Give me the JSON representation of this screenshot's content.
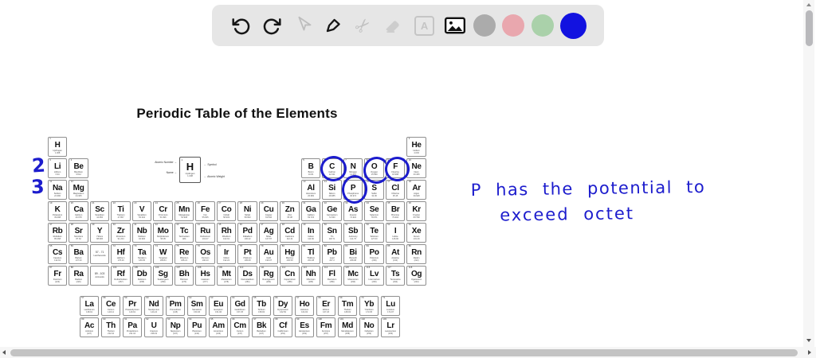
{
  "toolbar": {
    "text_tool_letter": "A",
    "tools": [
      {
        "id": "undo",
        "icon": "undo-arrow-icon",
        "enabled": true
      },
      {
        "id": "redo",
        "icon": "redo-arrow-icon",
        "enabled": true
      },
      {
        "id": "select",
        "icon": "cursor-icon",
        "enabled": false
      },
      {
        "id": "pen",
        "icon": "pen-icon",
        "enabled": true
      },
      {
        "id": "cut",
        "icon": "scissors-icon",
        "enabled": false
      },
      {
        "id": "eraser",
        "icon": "eraser-icon",
        "enabled": false
      },
      {
        "id": "text",
        "icon": "text-box-icon",
        "enabled": false
      },
      {
        "id": "image",
        "icon": "image-icon",
        "enabled": true
      }
    ],
    "color_swatches": [
      {
        "name": "gray",
        "hex": "#ababab",
        "selected": false
      },
      {
        "name": "pink",
        "hex": "#e9a7ae",
        "selected": false
      },
      {
        "name": "green",
        "hex": "#aad1aa",
        "selected": false
      },
      {
        "name": "blue",
        "hex": "#1212e0",
        "selected": true
      }
    ],
    "scissors_glyph": "✂"
  },
  "table": {
    "title": "Periodic Table of the Elements",
    "legend": {
      "atomic_number_label": "Atomic Number →",
      "name_label": "Name →",
      "symbol_label": "← Symbol",
      "atomic_weight_label": "← Atomic Weight",
      "example": {
        "n": "1",
        "s": "H",
        "nm": "Hydrogen",
        "w": "1.008"
      }
    },
    "group_placeholders": [
      {
        "r": 6,
        "c": 3,
        "range": "57 - 71",
        "label": "Lanthanoids"
      },
      {
        "r": 7,
        "c": 3,
        "range": "89 - 103",
        "label": "Actinoids"
      }
    ],
    "elements": [
      {
        "n": 1,
        "s": "H",
        "nm": "Hydrogen",
        "w": "1.008",
        "r": 1,
        "c": 1
      },
      {
        "n": 2,
        "s": "He",
        "nm": "Helium",
        "w": "4.003",
        "r": 1,
        "c": 18
      },
      {
        "n": 3,
        "s": "Li",
        "nm": "Lithium",
        "w": "6.94",
        "r": 2,
        "c": 1
      },
      {
        "n": 4,
        "s": "Be",
        "nm": "Beryllium",
        "w": "9.012",
        "r": 2,
        "c": 2
      },
      {
        "n": 5,
        "s": "B",
        "nm": "Boron",
        "w": "10.81",
        "r": 2,
        "c": 13
      },
      {
        "n": 6,
        "s": "C",
        "nm": "Carbon",
        "w": "12.011",
        "r": 2,
        "c": 14
      },
      {
        "n": 7,
        "s": "N",
        "nm": "Nitrogen",
        "w": "14.007",
        "r": 2,
        "c": 15
      },
      {
        "n": 8,
        "s": "O",
        "nm": "Oxygen",
        "w": "15.999",
        "r": 2,
        "c": 16
      },
      {
        "n": 9,
        "s": "F",
        "nm": "Fluorine",
        "w": "18.998",
        "r": 2,
        "c": 17
      },
      {
        "n": 10,
        "s": "Ne",
        "nm": "Neon",
        "w": "20.180",
        "r": 2,
        "c": 18
      },
      {
        "n": 11,
        "s": "Na",
        "nm": "Sodium",
        "w": "22.990",
        "r": 3,
        "c": 1
      },
      {
        "n": 12,
        "s": "Mg",
        "nm": "Magnesium",
        "w": "24.305",
        "r": 3,
        "c": 2
      },
      {
        "n": 13,
        "s": "Al",
        "nm": "Aluminium",
        "w": "26.982",
        "r": 3,
        "c": 13
      },
      {
        "n": 14,
        "s": "Si",
        "nm": "Silicon",
        "w": "28.085",
        "r": 3,
        "c": 14
      },
      {
        "n": 15,
        "s": "P",
        "nm": "Phosphorus",
        "w": "30.974",
        "r": 3,
        "c": 15
      },
      {
        "n": 16,
        "s": "S",
        "nm": "Sulfur",
        "w": "32.06",
        "r": 3,
        "c": 16
      },
      {
        "n": 17,
        "s": "Cl",
        "nm": "Chlorine",
        "w": "35.45",
        "r": 3,
        "c": 17
      },
      {
        "n": 18,
        "s": "Ar",
        "nm": "Argon",
        "w": "39.948",
        "r": 3,
        "c": 18
      },
      {
        "n": 19,
        "s": "K",
        "nm": "Potassium",
        "w": "39.098",
        "r": 4,
        "c": 1
      },
      {
        "n": 20,
        "s": "Ca",
        "nm": "Calcium",
        "w": "40.078",
        "r": 4,
        "c": 2
      },
      {
        "n": 21,
        "s": "Sc",
        "nm": "Scandium",
        "w": "44.956",
        "r": 4,
        "c": 3
      },
      {
        "n": 22,
        "s": "Ti",
        "nm": "Titanium",
        "w": "47.867",
        "r": 4,
        "c": 4
      },
      {
        "n": 23,
        "s": "V",
        "nm": "Vanadium",
        "w": "50.942",
        "r": 4,
        "c": 5
      },
      {
        "n": 24,
        "s": "Cr",
        "nm": "Chromium",
        "w": "51.996",
        "r": 4,
        "c": 6
      },
      {
        "n": 25,
        "s": "Mn",
        "nm": "Manganese",
        "w": "54.938",
        "r": 4,
        "c": 7
      },
      {
        "n": 26,
        "s": "Fe",
        "nm": "Iron",
        "w": "55.845",
        "r": 4,
        "c": 8
      },
      {
        "n": 27,
        "s": "Co",
        "nm": "Cobalt",
        "w": "58.933",
        "r": 4,
        "c": 9
      },
      {
        "n": 28,
        "s": "Ni",
        "nm": "Nickel",
        "w": "58.693",
        "r": 4,
        "c": 10
      },
      {
        "n": 29,
        "s": "Cu",
        "nm": "Copper",
        "w": "63.546",
        "r": 4,
        "c": 11
      },
      {
        "n": 30,
        "s": "Zn",
        "nm": "Zinc",
        "w": "65.38",
        "r": 4,
        "c": 12
      },
      {
        "n": 31,
        "s": "Ga",
        "nm": "Gallium",
        "w": "69.723",
        "r": 4,
        "c": 13
      },
      {
        "n": 32,
        "s": "Ge",
        "nm": "Germanium",
        "w": "72.630",
        "r": 4,
        "c": 14
      },
      {
        "n": 33,
        "s": "As",
        "nm": "Arsenic",
        "w": "74.922",
        "r": 4,
        "c": 15
      },
      {
        "n": 34,
        "s": "Se",
        "nm": "Selenium",
        "w": "78.971",
        "r": 4,
        "c": 16
      },
      {
        "n": 35,
        "s": "Br",
        "nm": "Bromine",
        "w": "79.904",
        "r": 4,
        "c": 17
      },
      {
        "n": 36,
        "s": "Kr",
        "nm": "Krypton",
        "w": "83.798",
        "r": 4,
        "c": 18
      },
      {
        "n": 37,
        "s": "Rb",
        "nm": "Rubidium",
        "w": "85.468",
        "r": 5,
        "c": 1
      },
      {
        "n": 38,
        "s": "Sr",
        "nm": "Strontium",
        "w": "87.62",
        "r": 5,
        "c": 2
      },
      {
        "n": 39,
        "s": "Y",
        "nm": "Yttrium",
        "w": "88.906",
        "r": 5,
        "c": 3
      },
      {
        "n": 40,
        "s": "Zr",
        "nm": "Zirconium",
        "w": "91.224",
        "r": 5,
        "c": 4
      },
      {
        "n": 41,
        "s": "Nb",
        "nm": "Niobium",
        "w": "92.906",
        "r": 5,
        "c": 5
      },
      {
        "n": 42,
        "s": "Mo",
        "nm": "Molybdenum",
        "w": "95.95",
        "r": 5,
        "c": 6
      },
      {
        "n": 43,
        "s": "Tc",
        "nm": "Technetium",
        "w": "(98)",
        "r": 5,
        "c": 7
      },
      {
        "n": 44,
        "s": "Ru",
        "nm": "Ruthenium",
        "w": "101.07",
        "r": 5,
        "c": 8
      },
      {
        "n": 45,
        "s": "Rh",
        "nm": "Rhodium",
        "w": "102.91",
        "r": 5,
        "c": 9
      },
      {
        "n": 46,
        "s": "Pd",
        "nm": "Palladium",
        "w": "106.42",
        "r": 5,
        "c": 10
      },
      {
        "n": 47,
        "s": "Ag",
        "nm": "Silver",
        "w": "107.87",
        "r": 5,
        "c": 11
      },
      {
        "n": 48,
        "s": "Cd",
        "nm": "Cadmium",
        "w": "112.41",
        "r": 5,
        "c": 12
      },
      {
        "n": 49,
        "s": "In",
        "nm": "Indium",
        "w": "114.82",
        "r": 5,
        "c": 13
      },
      {
        "n": 50,
        "s": "Sn",
        "nm": "Tin",
        "w": "118.71",
        "r": 5,
        "c": 14
      },
      {
        "n": 51,
        "s": "Sb",
        "nm": "Antimony",
        "w": "121.76",
        "r": 5,
        "c": 15
      },
      {
        "n": 52,
        "s": "Te",
        "nm": "Tellurium",
        "w": "127.60",
        "r": 5,
        "c": 16
      },
      {
        "n": 53,
        "s": "I",
        "nm": "Iodine",
        "w": "126.90",
        "r": 5,
        "c": 17
      },
      {
        "n": 54,
        "s": "Xe",
        "nm": "Xenon",
        "w": "131.29",
        "r": 5,
        "c": 18
      },
      {
        "n": 55,
        "s": "Cs",
        "nm": "Caesium",
        "w": "132.91",
        "r": 6,
        "c": 1
      },
      {
        "n": 56,
        "s": "Ba",
        "nm": "Barium",
        "w": "137.33",
        "r": 6,
        "c": 2
      },
      {
        "n": 72,
        "s": "Hf",
        "nm": "Hafnium",
        "w": "178.49",
        "r": 6,
        "c": 4
      },
      {
        "n": 73,
        "s": "Ta",
        "nm": "Tantalum",
        "w": "180.95",
        "r": 6,
        "c": 5
      },
      {
        "n": 74,
        "s": "W",
        "nm": "Tungsten",
        "w": "183.84",
        "r": 6,
        "c": 6
      },
      {
        "n": 75,
        "s": "Re",
        "nm": "Rhenium",
        "w": "186.21",
        "r": 6,
        "c": 7
      },
      {
        "n": 76,
        "s": "Os",
        "nm": "Osmium",
        "w": "190.23",
        "r": 6,
        "c": 8
      },
      {
        "n": 77,
        "s": "Ir",
        "nm": "Iridium",
        "w": "192.22",
        "r": 6,
        "c": 9
      },
      {
        "n": 78,
        "s": "Pt",
        "nm": "Platinum",
        "w": "195.08",
        "r": 6,
        "c": 10
      },
      {
        "n": 79,
        "s": "Au",
        "nm": "Gold",
        "w": "196.97",
        "r": 6,
        "c": 11
      },
      {
        "n": 80,
        "s": "Hg",
        "nm": "Mercury",
        "w": "200.59",
        "r": 6,
        "c": 12
      },
      {
        "n": 81,
        "s": "Tl",
        "nm": "Thallium",
        "w": "204.38",
        "r": 6,
        "c": 13
      },
      {
        "n": 82,
        "s": "Pb",
        "nm": "Lead",
        "w": "207.2",
        "r": 6,
        "c": 14
      },
      {
        "n": 83,
        "s": "Bi",
        "nm": "Bismuth",
        "w": "208.98",
        "r": 6,
        "c": 15
      },
      {
        "n": 84,
        "s": "Po",
        "nm": "Polonium",
        "w": "(209)",
        "r": 6,
        "c": 16
      },
      {
        "n": 85,
        "s": "At",
        "nm": "Astatine",
        "w": "(210)",
        "r": 6,
        "c": 17
      },
      {
        "n": 86,
        "s": "Rn",
        "nm": "Radon",
        "w": "(222)",
        "r": 6,
        "c": 18
      },
      {
        "n": 87,
        "s": "Fr",
        "nm": "Francium",
        "w": "(223)",
        "r": 7,
        "c": 1
      },
      {
        "n": 88,
        "s": "Ra",
        "nm": "Radium",
        "w": "(226)",
        "r": 7,
        "c": 2
      },
      {
        "n": 104,
        "s": "Rf",
        "nm": "Rutherfordium",
        "w": "(267)",
        "r": 7,
        "c": 4
      },
      {
        "n": 105,
        "s": "Db",
        "nm": "Dubnium",
        "w": "(268)",
        "r": 7,
        "c": 5
      },
      {
        "n": 106,
        "s": "Sg",
        "nm": "Seaborgium",
        "w": "(269)",
        "r": 7,
        "c": 6
      },
      {
        "n": 107,
        "s": "Bh",
        "nm": "Bohrium",
        "w": "(270)",
        "r": 7,
        "c": 7
      },
      {
        "n": 108,
        "s": "Hs",
        "nm": "Hassium",
        "w": "(277)",
        "r": 7,
        "c": 8
      },
      {
        "n": 109,
        "s": "Mt",
        "nm": "Meitnerium",
        "w": "(278)",
        "r": 7,
        "c": 9
      },
      {
        "n": 110,
        "s": "Ds",
        "nm": "Darmstadtium",
        "w": "(281)",
        "r": 7,
        "c": 10
      },
      {
        "n": 111,
        "s": "Rg",
        "nm": "Roentgenium",
        "w": "(282)",
        "r": 7,
        "c": 11
      },
      {
        "n": 112,
        "s": "Cn",
        "nm": "Copernicium",
        "w": "(285)",
        "r": 7,
        "c": 12
      },
      {
        "n": 113,
        "s": "Nh",
        "nm": "Nihonium",
        "w": "(286)",
        "r": 7,
        "c": 13
      },
      {
        "n": 114,
        "s": "Fl",
        "nm": "Flerovium",
        "w": "(289)",
        "r": 7,
        "c": 14
      },
      {
        "n": 115,
        "s": "Mc",
        "nm": "Moscovium",
        "w": "(290)",
        "r": 7,
        "c": 15
      },
      {
        "n": 116,
        "s": "Lv",
        "nm": "Livermorium",
        "w": "(293)",
        "r": 7,
        "c": 16
      },
      {
        "n": 117,
        "s": "Ts",
        "nm": "Tennessine",
        "w": "(294)",
        "r": 7,
        "c": 17
      },
      {
        "n": 118,
        "s": "Og",
        "nm": "Oganesson",
        "w": "(294)",
        "r": 7,
        "c": 18
      },
      {
        "n": 57,
        "s": "La",
        "nm": "Lanthanum",
        "w": "138.91",
        "r": 8,
        "c": 1
      },
      {
        "n": 58,
        "s": "Ce",
        "nm": "Cerium",
        "w": "140.12",
        "r": 8,
        "c": 2
      },
      {
        "n": 59,
        "s": "Pr",
        "nm": "Praseodymium",
        "w": "140.91",
        "r": 8,
        "c": 3
      },
      {
        "n": 60,
        "s": "Nd",
        "nm": "Neodymium",
        "w": "144.24",
        "r": 8,
        "c": 4
      },
      {
        "n": 61,
        "s": "Pm",
        "nm": "Promethium",
        "w": "(145)",
        "r": 8,
        "c": 5
      },
      {
        "n": 62,
        "s": "Sm",
        "nm": "Samarium",
        "w": "150.36",
        "r": 8,
        "c": 6
      },
      {
        "n": 63,
        "s": "Eu",
        "nm": "Europium",
        "w": "151.96",
        "r": 8,
        "c": 7
      },
      {
        "n": 64,
        "s": "Gd",
        "nm": "Gadolinium",
        "w": "157.25",
        "r": 8,
        "c": 8
      },
      {
        "n": 65,
        "s": "Tb",
        "nm": "Terbium",
        "w": "158.93",
        "r": 8,
        "c": 9
      },
      {
        "n": 66,
        "s": "Dy",
        "nm": "Dysprosium",
        "w": "162.50",
        "r": 8,
        "c": 10
      },
      {
        "n": 67,
        "s": "Ho",
        "nm": "Holmium",
        "w": "164.93",
        "r": 8,
        "c": 11
      },
      {
        "n": 68,
        "s": "Er",
        "nm": "Erbium",
        "w": "167.26",
        "r": 8,
        "c": 12
      },
      {
        "n": 69,
        "s": "Tm",
        "nm": "Thulium",
        "w": "168.93",
        "r": 8,
        "c": 13
      },
      {
        "n": 70,
        "s": "Yb",
        "nm": "Ytterbium",
        "w": "173.05",
        "r": 8,
        "c": 14
      },
      {
        "n": 71,
        "s": "Lu",
        "nm": "Lutetium",
        "w": "174.97",
        "r": 8,
        "c": 15
      },
      {
        "n": 89,
        "s": "Ac",
        "nm": "Actinium",
        "w": "(227)",
        "r": 9,
        "c": 1
      },
      {
        "n": 90,
        "s": "Th",
        "nm": "Thorium",
        "w": "232.04",
        "r": 9,
        "c": 2
      },
      {
        "n": 91,
        "s": "Pa",
        "nm": "Protactinium",
        "w": "231.04",
        "r": 9,
        "c": 3
      },
      {
        "n": 92,
        "s": "U",
        "nm": "Uranium",
        "w": "238.03",
        "r": 9,
        "c": 4
      },
      {
        "n": 93,
        "s": "Np",
        "nm": "Neptunium",
        "w": "(237)",
        "r": 9,
        "c": 5
      },
      {
        "n": 94,
        "s": "Pu",
        "nm": "Plutonium",
        "w": "(244)",
        "r": 9,
        "c": 6
      },
      {
        "n": 95,
        "s": "Am",
        "nm": "Americium",
        "w": "(243)",
        "r": 9,
        "c": 7
      },
      {
        "n": 96,
        "s": "Cm",
        "nm": "Curium",
        "w": "(247)",
        "r": 9,
        "c": 8
      },
      {
        "n": 97,
        "s": "Bk",
        "nm": "Berkelium",
        "w": "(247)",
        "r": 9,
        "c": 9
      },
      {
        "n": 98,
        "s": "Cf",
        "nm": "Californium",
        "w": "(251)",
        "r": 9,
        "c": 10
      },
      {
        "n": 99,
        "s": "Es",
        "nm": "Einsteinium",
        "w": "(252)",
        "r": 9,
        "c": 11
      },
      {
        "n": 100,
        "s": "Fm",
        "nm": "Fermium",
        "w": "(257)",
        "r": 9,
        "c": 12
      },
      {
        "n": 101,
        "s": "Md",
        "nm": "Mendelevium",
        "w": "(258)",
        "r": 9,
        "c": 13
      },
      {
        "n": 102,
        "s": "No",
        "nm": "Nobelium",
        "w": "(259)",
        "r": 9,
        "c": 14
      },
      {
        "n": 103,
        "s": "Lr",
        "nm": "Lawrencium",
        "w": "(266)",
        "r": 9,
        "c": 15
      }
    ]
  },
  "annotations": {
    "ink_color": "#1c1ccd",
    "period_labels": [
      "2",
      "3"
    ],
    "circled_elements": [
      "C",
      "O",
      "F",
      "P"
    ],
    "note": {
      "line1": "P has the potential to",
      "line2": "exceed octet"
    }
  }
}
